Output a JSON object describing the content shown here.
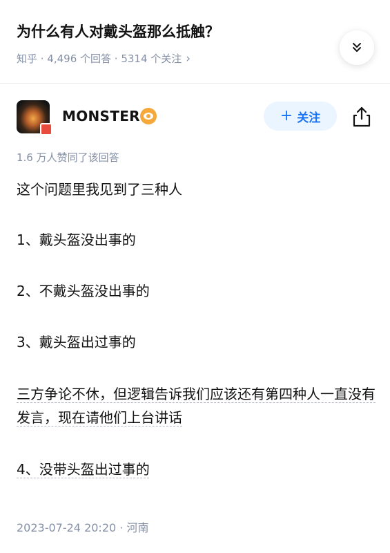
{
  "question": {
    "title": "为什么有人对戴头盔那么抵触？",
    "meta": "知乎 · 4,496 个回答 · 5314 个关注"
  },
  "author": {
    "name": "MONSTER",
    "follow_label": "关注"
  },
  "answer": {
    "vote_summary": "1.6 万人赞同了该回答",
    "paragraphs": [
      "这个问题里我见到了三种人",
      "1、戴头盔没出事的",
      "2、不戴头盔没出事的",
      "3、戴头盔出过事的",
      "三方争论不休，但逻辑告诉我们应该还有第四种人一直没有发言，现在请他们上台讲话",
      "4、没带头盔出过事的"
    ],
    "footer": "2023-07-24 20:20 · 河南"
  },
  "colors": {
    "accent": "#1772f6",
    "follow_bg": "#ebf5ff",
    "meta_text": "#8590a6",
    "badge": "#f6a93b"
  },
  "icons": [
    "chevron-right-icon",
    "double-chevron-down-icon",
    "verified-badge-icon",
    "plus-icon",
    "share-icon"
  ]
}
